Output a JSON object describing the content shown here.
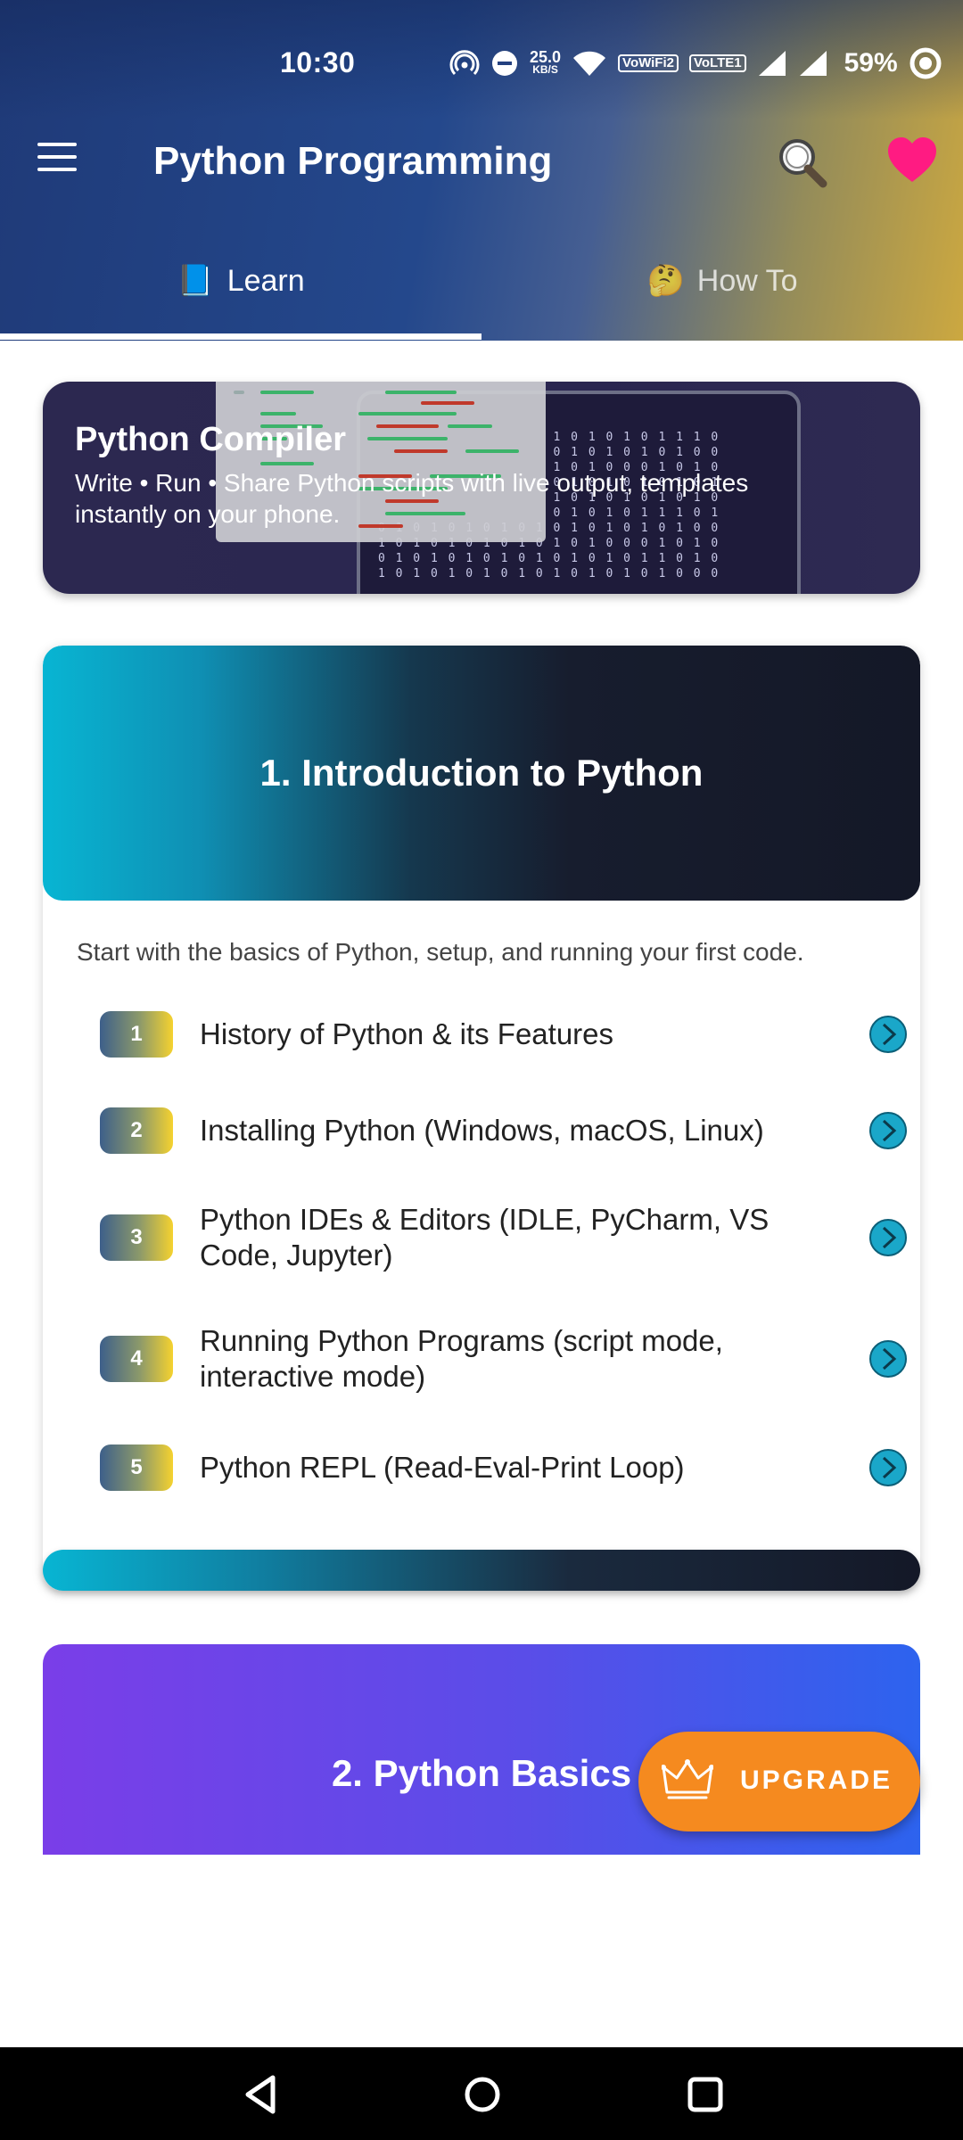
{
  "status_bar": {
    "time": "10:30",
    "net_speed_value": "25.0",
    "net_speed_unit": "KB/S",
    "wifi_badge": "Vo̅ WiFi2",
    "lte_badge": "Vo LTE1",
    "battery": "59%"
  },
  "app_bar": {
    "title": "Python Programming",
    "icons": [
      "menu-icon",
      "search-icon",
      "heart-icon"
    ],
    "heart_color": "#ff1b82"
  },
  "tabs": [
    {
      "emoji": "📘",
      "label": "Learn",
      "selected": true
    },
    {
      "emoji": "🤔",
      "label": "How To",
      "selected": false
    }
  ],
  "banner": {
    "title": "Python Compiler",
    "description": "Write • Run • Share Python scripts with live output, templates instantly on your phone."
  },
  "sections": [
    {
      "title": "1. Introduction to Python",
      "description": "Start with the basics of Python, setup, and running your first code.",
      "topics": [
        {
          "num": "1",
          "label": "History of Python & its Features"
        },
        {
          "num": "2",
          "label": "Installing Python (Windows, macOS, Linux)"
        },
        {
          "num": "3",
          "label": "Python IDEs & Editors (IDLE, PyCharm, VS Code, Jupyter)"
        },
        {
          "num": "4",
          "label": "Running Python Programs (script mode, interactive mode)"
        },
        {
          "num": "5",
          "label": "Python REPL (Read-Eval-Print Loop)"
        }
      ]
    },
    {
      "title": "2. Python Basics"
    }
  ],
  "fab": {
    "label": "UPGRADE",
    "icon": "crown-icon",
    "color": "#f58a1f"
  },
  "colors": {
    "accent_cyan": "#08b5d3",
    "card_dark": "#141827",
    "section2_purple": "#7a3ee8"
  }
}
